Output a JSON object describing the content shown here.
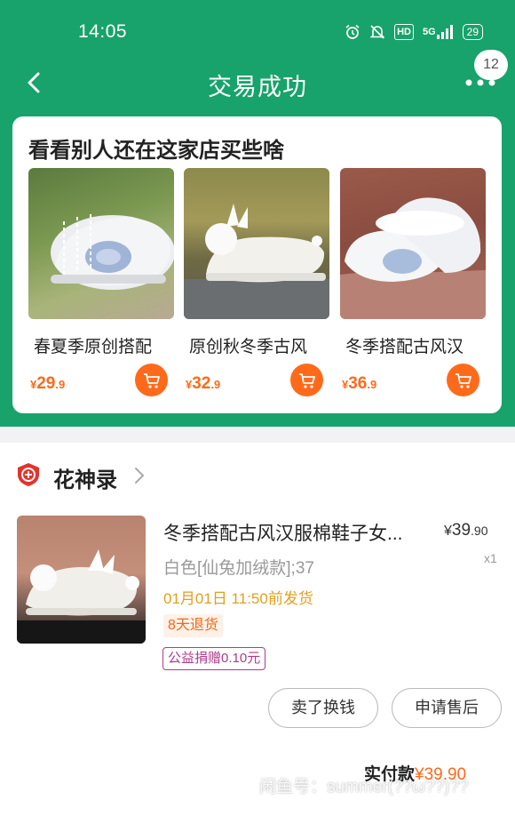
{
  "status_bar": {
    "time": "14:05",
    "hd": "HD",
    "signal": "5G",
    "battery": "29"
  },
  "nav": {
    "title": "交易成功",
    "badge": "12"
  },
  "recommend": {
    "title": "看看别人还在这家店买些啥",
    "products": [
      {
        "name": "春夏季原创搭配",
        "currency": "¥",
        "price_int": "29",
        "price_dec": ".9"
      },
      {
        "name": "原创秋冬季古风",
        "currency": "¥",
        "price_int": "32",
        "price_dec": ".9"
      },
      {
        "name": "冬季搭配古风汉",
        "currency": "¥",
        "price_int": "36",
        "price_dec": ".9"
      }
    ]
  },
  "order": {
    "shop_name": "花神录",
    "item_name": "冬季搭配古风汉服棉鞋子女...",
    "currency": "¥",
    "price_int": "39",
    "price_dec": ".90",
    "spec": "白色[仙兔加绒款];37",
    "qty": "x1",
    "ship_time": "01月01日 11:50前发货",
    "return_tag": "8天退货",
    "charity_tag": "公益捐赠0.10元",
    "buttons": {
      "sell": "卖了换钱",
      "after_sale": "申请售后"
    },
    "paid_label": "实付款",
    "paid_amount": "¥39.90"
  },
  "watermark": "闲鱼号：summer(??ω??)??",
  "colors": {
    "brand_green": "#17a36b",
    "price_orange": "#ff6a1a"
  }
}
